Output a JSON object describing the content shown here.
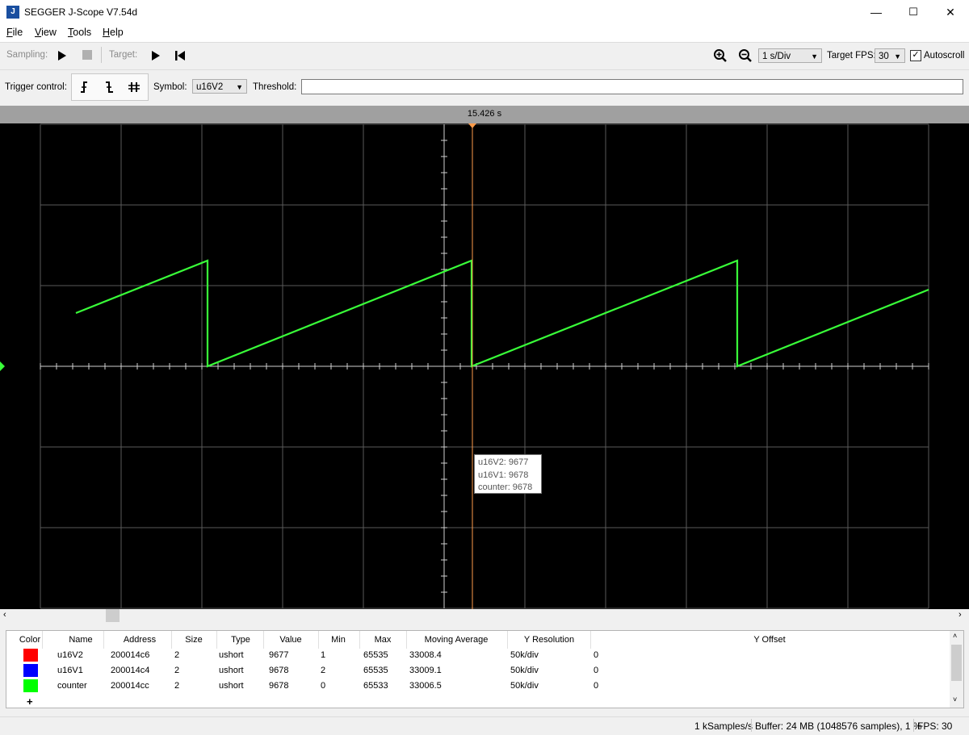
{
  "window": {
    "title": "SEGGER J-Scope V7.54d",
    "app_icon": "J",
    "minimize": "—",
    "maximize": "☐",
    "close": "✕"
  },
  "menu": [
    "File",
    "View",
    "Tools",
    "Help"
  ],
  "toolbar": {
    "sampling_label": "Sampling:",
    "target_label": "Target:",
    "timebase": "1 s/Div",
    "fps_label": "Target FPS:",
    "fps_value": "30",
    "autoscroll_label": "Autoscroll",
    "autoscroll_checked": true
  },
  "trigger": {
    "label": "Trigger control:",
    "symbol_label": "Symbol:",
    "symbol_value": "u16V2",
    "threshold_label": "Threshold:",
    "threshold_value": ""
  },
  "scope": {
    "cursor_time": "15.426 s",
    "trace_color": "#39ff39",
    "cursor_color": "#ff9b4a",
    "tooltip": [
      "u16V2: 9677",
      "u16V1: 9678",
      "counter: 9678"
    ]
  },
  "table": {
    "headers": [
      "Color",
      "Name",
      "Address",
      "Size",
      "Type",
      "Value",
      "Min",
      "Max",
      "Moving Average",
      "Y Resolution",
      "Y Offset"
    ],
    "rows": [
      {
        "color": "#ff0000",
        "name": "u16V2",
        "address": "200014c6",
        "size": "2",
        "type": "ushort",
        "value": "9677",
        "min": "1",
        "max": "65535",
        "avg": "33008.4",
        "yres": "50k/div",
        "yoff": "0"
      },
      {
        "color": "#0000ff",
        "name": "u16V1",
        "address": "200014c4",
        "size": "2",
        "type": "ushort",
        "value": "9678",
        "min": "2",
        "max": "65535",
        "avg": "33009.1",
        "yres": "50k/div",
        "yoff": "0"
      },
      {
        "color": "#00ff00",
        "name": "counter",
        "address": "200014cc",
        "size": "2",
        "type": "ushort",
        "value": "9678",
        "min": "0",
        "max": "65533",
        "avg": "33006.5",
        "yres": "50k/div",
        "yoff": "0"
      }
    ],
    "add_label": "+"
  },
  "status": {
    "rate": "1 kSamples/s",
    "buffer": "Buffer: 24 MB (1048576 samples), 1 %",
    "fps": "FPS: 30"
  }
}
